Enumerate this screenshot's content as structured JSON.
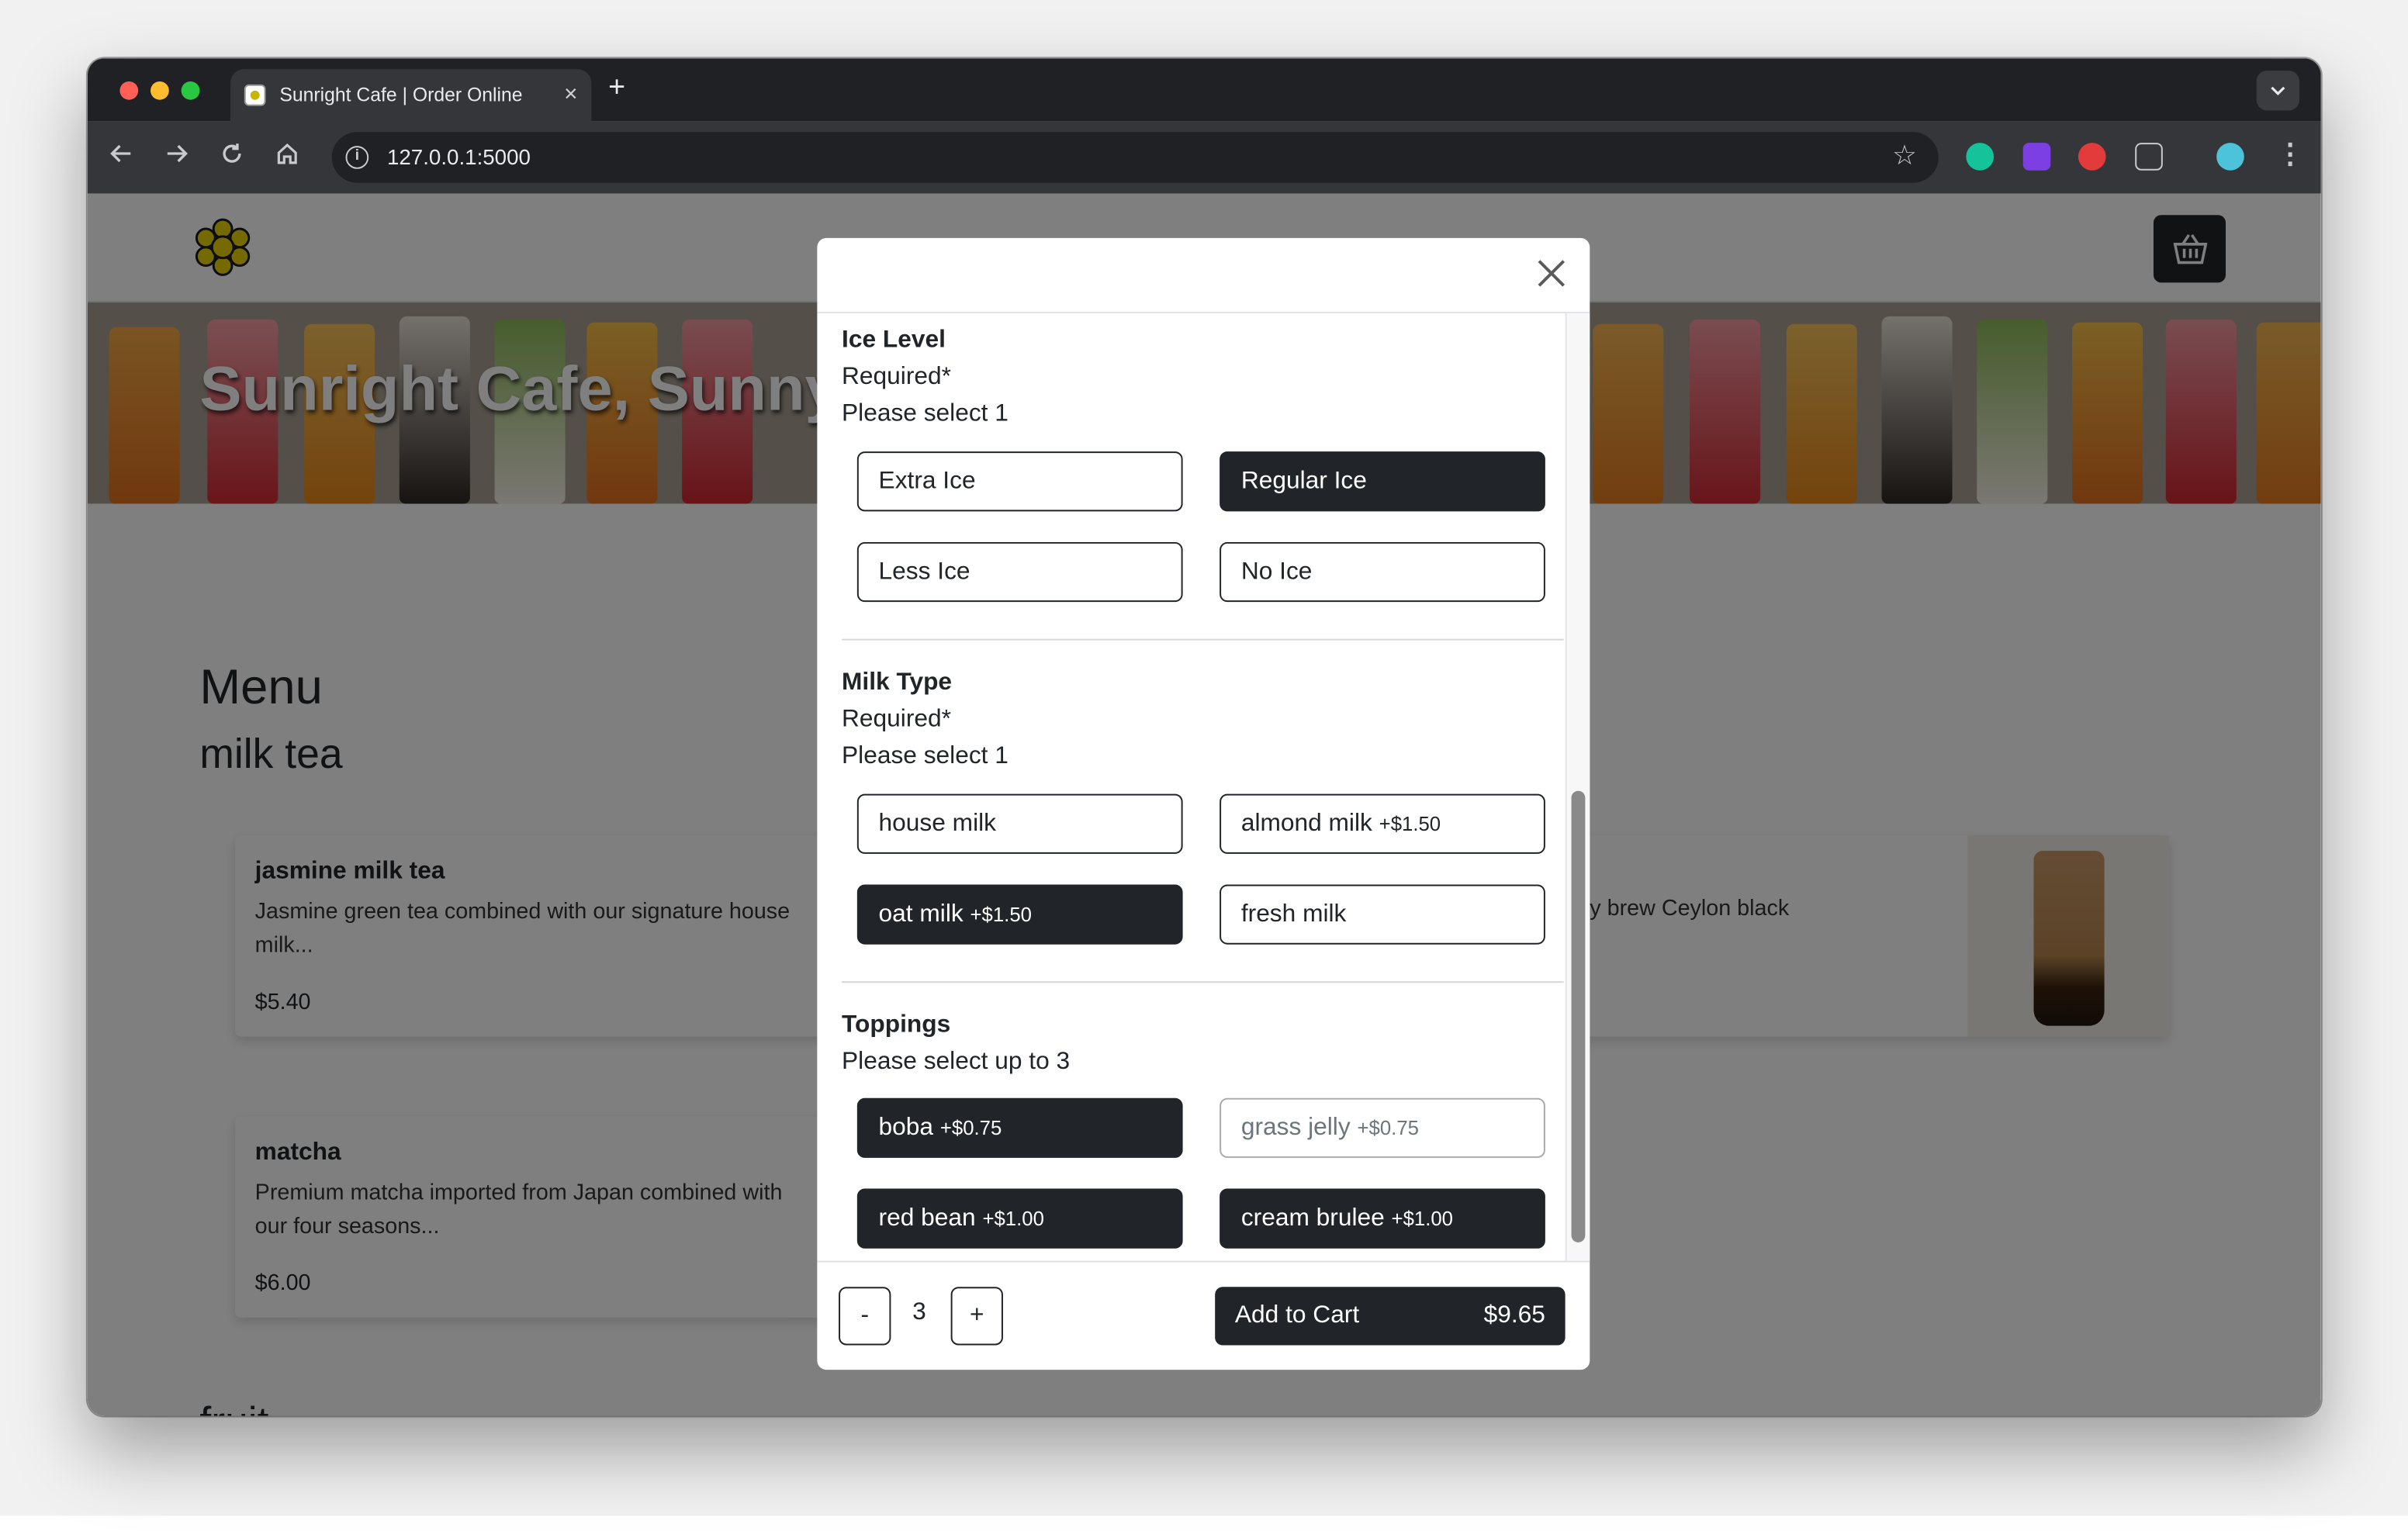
{
  "browser": {
    "tab_title": "Sunright Cafe | Order Online",
    "tab_close": "×",
    "new_tab": "+",
    "url": "127.0.0.1:5000"
  },
  "site": {
    "hero_title": "Sunright Cafe, Sunnyvale",
    "menu_heading": "Menu",
    "category": "milk tea",
    "next_category": "fruit"
  },
  "menu_items": [
    {
      "name": "jasmine milk tea",
      "description": "Jasmine green tea combined with our signature house milk...",
      "price": "$5.40"
    },
    {
      "description_fragment": "y brew Ceylon black"
    },
    {
      "name": "matcha",
      "description": "Premium matcha imported from Japan combined with our four seasons...",
      "price": "$6.00"
    }
  ],
  "modal": {
    "groups": [
      {
        "title": "Ice Level",
        "required": "Required*",
        "hint": "Please select 1",
        "options": [
          {
            "label": "Extra Ice",
            "price": "",
            "state": "unselected"
          },
          {
            "label": "Regular Ice",
            "price": "",
            "state": "selected"
          },
          {
            "label": "Less Ice",
            "price": "",
            "state": "unselected"
          },
          {
            "label": "No Ice",
            "price": "",
            "state": "unselected"
          }
        ]
      },
      {
        "title": "Milk Type",
        "required": "Required*",
        "hint": "Please select 1",
        "options": [
          {
            "label": "house milk",
            "price": "",
            "state": "unselected"
          },
          {
            "label": "almond milk",
            "price": "+$1.50",
            "state": "unselected"
          },
          {
            "label": "oat milk",
            "price": "+$1.50",
            "state": "selected"
          },
          {
            "label": "fresh milk",
            "price": "",
            "state": "unselected"
          }
        ]
      },
      {
        "title": "Toppings",
        "hint": "Please select up to 3",
        "options": [
          {
            "label": "boba",
            "price": "+$0.75",
            "state": "selected"
          },
          {
            "label": "grass jelly",
            "price": "+$0.75",
            "state": "disabled"
          },
          {
            "label": "red bean",
            "price": "+$1.00",
            "state": "selected"
          },
          {
            "label": "cream brulee",
            "price": "+$1.00",
            "state": "selected"
          }
        ]
      }
    ],
    "quantity": "3",
    "minus": "-",
    "plus": "+",
    "add_to_cart": "Add to Cart",
    "total": "$9.65"
  },
  "colors": {
    "primary": "#212529",
    "overlay": "rgba(0,0,0,0.5)"
  },
  "icons": [
    "close-icon",
    "basket-icon",
    "sunflower-logo",
    "back-icon",
    "forward-icon",
    "reload-icon",
    "home-icon",
    "info-icon",
    "star-icon",
    "kebab-menu-icon"
  ]
}
